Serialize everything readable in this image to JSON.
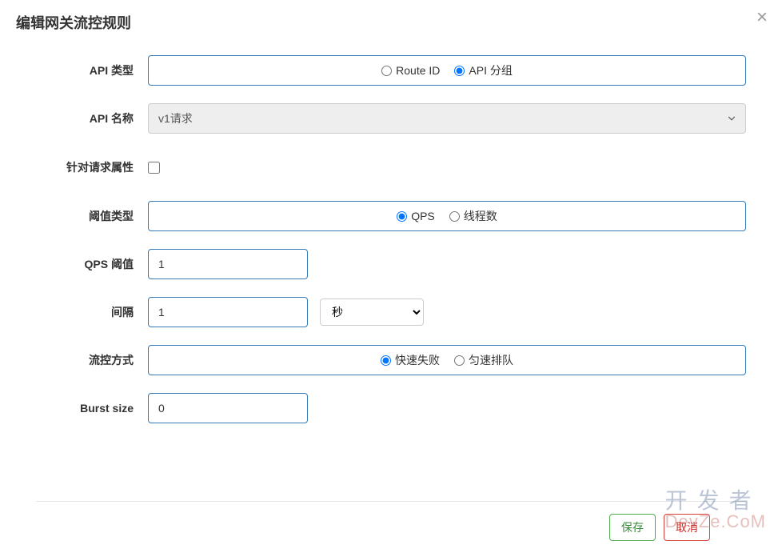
{
  "modal": {
    "title": "编辑网关流控规则"
  },
  "form": {
    "api_type": {
      "label": "API 类型",
      "options": [
        "Route ID",
        "API 分组"
      ],
      "selected": "API 分组"
    },
    "api_name": {
      "label": "API 名称",
      "value": "v1请求"
    },
    "request_attr": {
      "label": "针对请求属性",
      "checked": false
    },
    "threshold_type": {
      "label": "阈值类型",
      "options": [
        "QPS",
        "线程数"
      ],
      "selected": "QPS"
    },
    "qps_threshold": {
      "label": "QPS 阈值",
      "value": "1"
    },
    "interval": {
      "label": "间隔",
      "value": "1",
      "unit": "秒"
    },
    "flow_mode": {
      "label": "流控方式",
      "options": [
        "快速失败",
        "匀速排队"
      ],
      "selected": "快速失败"
    },
    "burst_size": {
      "label": "Burst size",
      "value": "0"
    }
  },
  "buttons": {
    "save": "保存",
    "cancel": "取消"
  },
  "watermark": {
    "line1": "开发者",
    "line2": "DevZe.CoM"
  }
}
